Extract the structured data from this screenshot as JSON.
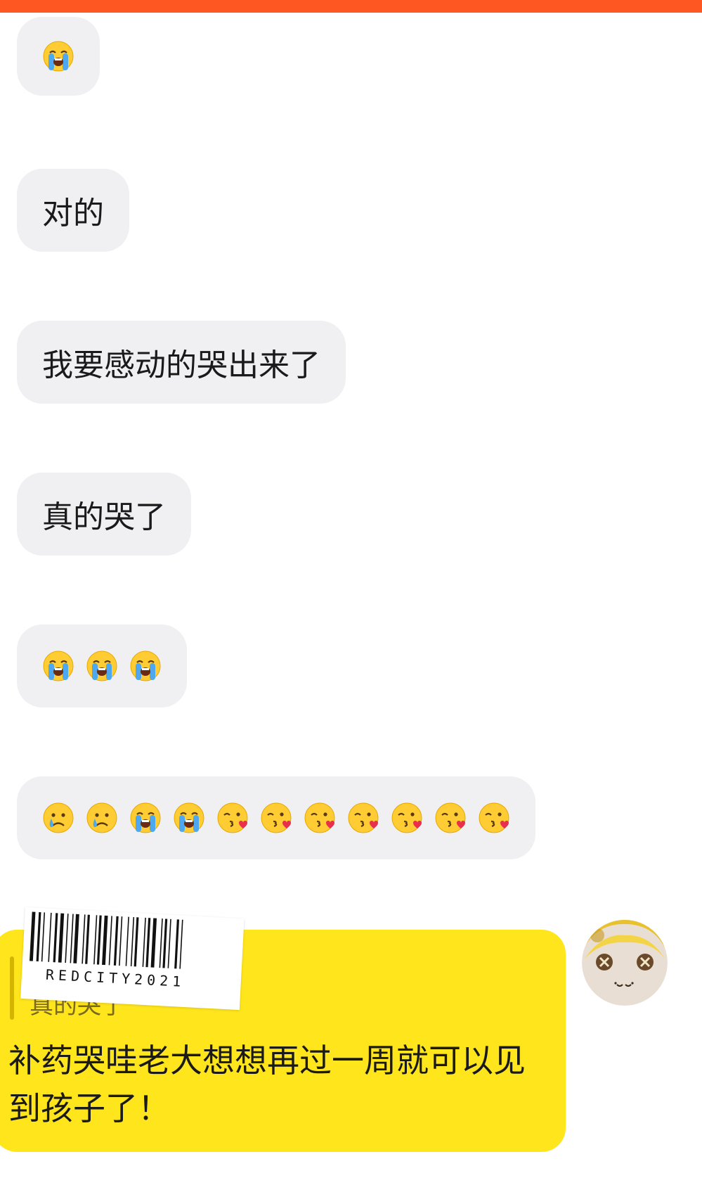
{
  "colors": {
    "top_bar": "#ff5722",
    "incoming_bubble": "#f0f0f3",
    "outgoing_bubble": "#ffe51c",
    "background": "#ffffff"
  },
  "messages": [
    {
      "type": "emoji",
      "emojis": [
        "loudly-crying-face"
      ]
    },
    {
      "type": "text",
      "text": "对的"
    },
    {
      "type": "text",
      "text": "我要感动的哭出来了"
    },
    {
      "type": "text",
      "text": "真的哭了"
    },
    {
      "type": "emoji",
      "emojis": [
        "loudly-crying-face",
        "loudly-crying-face",
        "loudly-crying-face"
      ]
    },
    {
      "type": "emoji",
      "emojis": [
        "crying-face",
        "crying-face",
        "loudly-crying-face",
        "loudly-crying-face",
        "face-blowing-kiss",
        "face-blowing-kiss",
        "face-blowing-kiss",
        "face-blowing-kiss",
        "face-blowing-kiss",
        "face-blowing-kiss",
        "face-blowing-kiss"
      ]
    }
  ],
  "reply": {
    "quoted_text": "真的哭了",
    "text": "补药哭哇老大想想再过一周就可以见到孩子了！"
  },
  "sticker": {
    "caption": "REDCITY2021"
  },
  "avatar": {
    "icon": "plush-doll-avatar"
  }
}
